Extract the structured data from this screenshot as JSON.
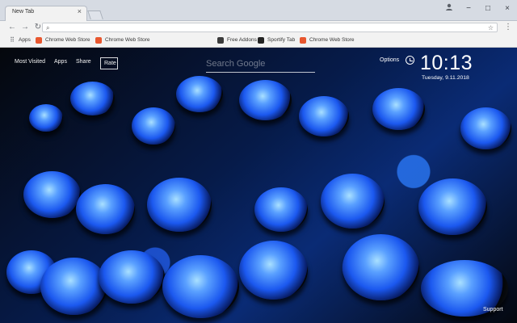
{
  "window": {
    "tab_title": "New Tab",
    "tab_close": "×",
    "controls": {
      "profile_icon": "person-icon",
      "minimize": "−",
      "maximize": "□",
      "close": "×"
    }
  },
  "toolbar": {
    "back": "←",
    "forward": "→",
    "reload": "↻",
    "search_icon": "⌕",
    "star": "☆",
    "menu": "⋮"
  },
  "bookmarks": [
    {
      "label": "Apps",
      "icon": "apps-grid-icon"
    },
    {
      "label": "Chrome Web Store",
      "icon": "chrome-web-store-icon"
    },
    {
      "label": "Chrome Web Store",
      "icon": "chrome-web-store-icon"
    },
    {
      "label": "Free Addons",
      "icon": "free-addons-icon"
    },
    {
      "label": "Sportify Tab",
      "icon": "spotify-icon"
    },
    {
      "label": "Chrome Web Store",
      "icon": "chrome-web-store-icon"
    }
  ],
  "newtab": {
    "nav": {
      "most_visited": "Most Visited",
      "apps": "Apps",
      "share": "Share",
      "rate": "Rate"
    },
    "search_placeholder": "Search Google",
    "options": "Options",
    "time": "10:13",
    "date": "Tuesday, 9.11.2018",
    "support": "Support"
  },
  "colors": {
    "background_blue": "#1d5bff",
    "dark": "#05070c"
  }
}
